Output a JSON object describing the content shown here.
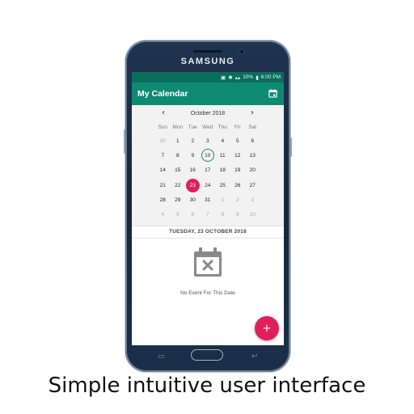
{
  "device": {
    "brand": "SAMSUNG"
  },
  "status_bar": {
    "battery": "10%",
    "time": "6:00 PM",
    "icons": [
      "sync-icon",
      "bluetooth-icon",
      "data-icon",
      "signal-icon",
      "battery-icon"
    ]
  },
  "app_bar": {
    "title": "My Calendar",
    "action_icon": "calendar-icon"
  },
  "calendar": {
    "month_label": "October 2018",
    "prev_icon": "‹",
    "next_icon": "›",
    "weekdays": [
      "Sun",
      "Mon",
      "Tue",
      "Wed",
      "Thu",
      "Fri",
      "Sat"
    ],
    "weeks": [
      [
        "30",
        "1",
        "2",
        "3",
        "4",
        "5",
        "6"
      ],
      [
        "7",
        "8",
        "9",
        "10",
        "11",
        "12",
        "13"
      ],
      [
        "14",
        "15",
        "16",
        "17",
        "18",
        "19",
        "20"
      ],
      [
        "21",
        "22",
        "23",
        "24",
        "25",
        "26",
        "27"
      ],
      [
        "28",
        "29",
        "30",
        "31",
        "1",
        "2",
        "3"
      ],
      [
        "4",
        "5",
        "6",
        "7",
        "8",
        "9",
        "10"
      ]
    ],
    "today": "10",
    "selected": "23"
  },
  "selected_date_label": "TUESDAY, 23 OCTOBER 2018",
  "empty_state": {
    "icon": "calendar-remove-icon",
    "text": "No Event For This Date"
  },
  "fab": {
    "label": "+"
  },
  "caption": "Simple intuitive user interface",
  "colors": {
    "primary": "#0e8a73",
    "primary_dark": "#0a6d5b",
    "accent": "#e01f5e"
  }
}
